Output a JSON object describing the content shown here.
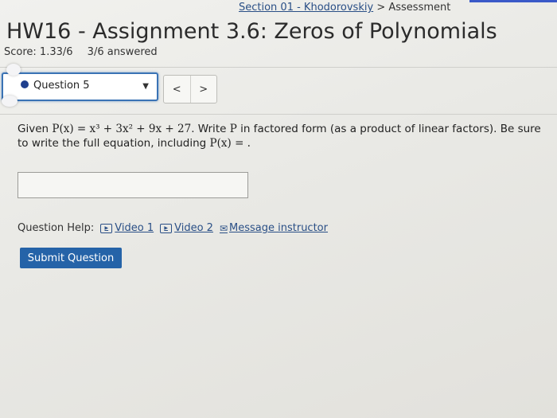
{
  "header": {
    "breadcrumb_prefix": "Section 01 - Khodorovskiy",
    "breadcrumb_sep": ">",
    "breadcrumb_current": "Assessment",
    "title": "HW16 - Assignment 3.6: Zeros of Polynomials"
  },
  "score": {
    "label": "Score: 1.33/6",
    "answered": "3/6 answered"
  },
  "question_nav": {
    "selected": "Question 5",
    "prev_label": "<",
    "next_label": ">"
  },
  "question": {
    "given": "Given ",
    "function_def": "P(x) = x³ + 3x² + 9x + 27",
    "instruction_1": ". Write ",
    "var": "P",
    "instruction_2": " in factored form (as a product of linear factors). Be sure to write the full equation, including ",
    "equation_start": "P(x) = .",
    "answer_value": ""
  },
  "help": {
    "label": "Question Help:",
    "video1": "Video 1",
    "video2": "Video 2",
    "message": "Message instructor"
  },
  "actions": {
    "submit": "Submit Question"
  },
  "colors": {
    "accent": "#2563a8",
    "link": "#2a4f86",
    "dot": "#1f3f8e"
  },
  "icons": {
    "video": "video-play-icon",
    "mail": "envelope-icon",
    "caret": "chevron-down-icon"
  }
}
